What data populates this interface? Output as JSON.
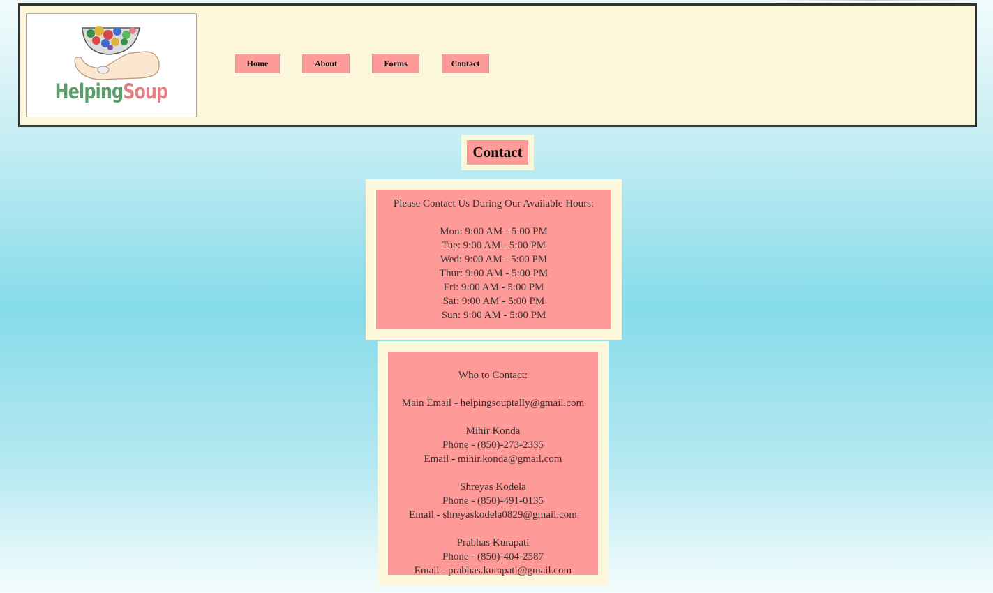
{
  "header": {
    "logo": {
      "word1": "Helping",
      "word2": "Soup",
      "icon": "bowl-in-hand-icon"
    },
    "nav": [
      {
        "label": "Home"
      },
      {
        "label": "About"
      },
      {
        "label": "Forms"
      },
      {
        "label": "Contact"
      }
    ]
  },
  "page": {
    "title": "Contact"
  },
  "hours": {
    "heading": "Please Contact Us During Our Available Hours:",
    "days": [
      "Mon: 9:00 AM - 5:00 PM",
      "Tue: 9:00 AM - 5:00 PM",
      "Wed: 9:00 AM - 5:00 PM",
      "Thur: 9:00 AM - 5:00 PM",
      "Fri: 9:00 AM - 5:00 PM",
      "Sat: 9:00 AM - 5:00 PM",
      "Sun: 9:00 AM - 5:00 PM"
    ]
  },
  "contacts": {
    "heading": "Who to Contact:",
    "main_email": "Main Email - helpingsouptally@gmail.com",
    "people": [
      {
        "name": "Mihir Konda",
        "phone": "Phone - (850)-273-2335",
        "email": "Email - mihir.konda@gmail.com"
      },
      {
        "name": "Shreyas Kodela",
        "phone": "Phone - (850)-491-0135",
        "email": "Email - shreyaskodela0829@gmail.com"
      },
      {
        "name": "Prabhas Kurapati",
        "phone": "Phone - (850)-404-2587",
        "email": "Email - prabhas.kurapati@gmail.com"
      }
    ]
  },
  "colors": {
    "header_bg": "#fcf6da",
    "button_bg": "#fe9a98",
    "page_bg_mid": "#86dbea"
  }
}
